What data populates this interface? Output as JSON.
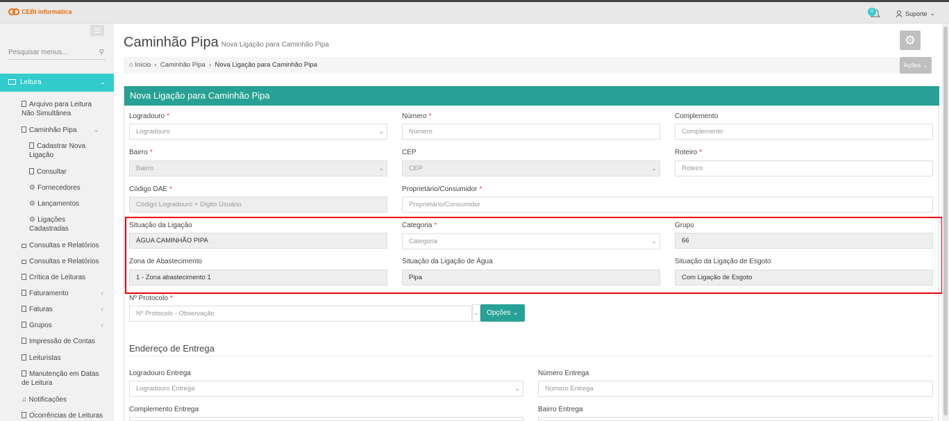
{
  "header": {
    "brand": "CEBI informática",
    "notif_count": "0",
    "user": "Suporte"
  },
  "sidebar": {
    "search_placeholder": "Pesquisar menus...",
    "active": "Leitura",
    "items": [
      {
        "label": "Arquivo para Leitura Não Simultânea"
      },
      {
        "label": "Caminhão Pipa"
      },
      {
        "label": "Cadastrar Nova Ligação"
      },
      {
        "label": "Consultar"
      },
      {
        "label": "Fornecedores"
      },
      {
        "label": "Lançamentos"
      },
      {
        "label": "Ligações Cadastradas"
      },
      {
        "label": "Consultas e Relatórios"
      },
      {
        "label": "Consultas e Relatórios"
      },
      {
        "label": "Crítica de Leituras"
      },
      {
        "label": "Faturamento"
      },
      {
        "label": "Faturas"
      },
      {
        "label": "Grupos"
      },
      {
        "label": "Impressão de Contas"
      },
      {
        "label": "Leituristas"
      },
      {
        "label": "Manutenção em Datas de Leitura"
      },
      {
        "label": "Notificações"
      },
      {
        "label": "Ocorrências de Leituras"
      }
    ]
  },
  "page": {
    "title": "Caminhão Pipa",
    "subtitle": "Nova Ligação para Caminhão Pipa",
    "actions": "Ações"
  },
  "breadcrumb": {
    "home": "Início",
    "level1": "Caminhão Pipa",
    "current": "Nova Ligação para Caminhão Pipa"
  },
  "form": {
    "title": "Nova Ligação para Caminhão Pipa",
    "logradouro": {
      "label": "Logradouro",
      "placeholder": "Logradouro"
    },
    "numero": {
      "label": "Número",
      "placeholder": "Número"
    },
    "complemento": {
      "label": "Complemento",
      "placeholder": "Complemento"
    },
    "bairro": {
      "label": "Bairro",
      "placeholder": "Bairro"
    },
    "cep": {
      "label": "CEP",
      "placeholder": "CEP"
    },
    "roteiro": {
      "label": "Roteiro",
      "placeholder": "Roteiro"
    },
    "codigo_dae": {
      "label": "Código DAE",
      "placeholder": "Código Logradouro + Digito Usuário"
    },
    "proprietario": {
      "label": "Proprietário/Consumidor",
      "placeholder": "Proprietário/Consumidor"
    },
    "situacao": {
      "label": "Situação da Ligação",
      "value": "ÁGUA CAMINHÃO PIPA"
    },
    "categoria": {
      "label": "Categoria",
      "placeholder": "Categoria"
    },
    "grupo": {
      "label": "Grupo",
      "value": "66"
    },
    "zona": {
      "label": "Zona de Abastecimento",
      "value": "1 - Zona abastecimento 1"
    },
    "sit_agua": {
      "label": "Situação da Ligação de Água",
      "value": "Pipa"
    },
    "sit_esgoto": {
      "label": "Situação da Ligação de Esgoto",
      "value": "Com Ligação de Esgoto"
    },
    "protocolo": {
      "label": "Nº Protocolo",
      "placeholder": "Nº Protocolo - Observação",
      "options": "Opções"
    },
    "entrega": {
      "section": "Endereço de Entrega",
      "logradouro": {
        "label": "Logradouro Entrega",
        "placeholder": "Logradouro Entrega"
      },
      "numero": {
        "label": "Número Entrega",
        "placeholder": "Número Entrega"
      },
      "complemento": {
        "label": "Complemento Entrega"
      },
      "bairro": {
        "label": "Bairro Entrega"
      }
    }
  }
}
